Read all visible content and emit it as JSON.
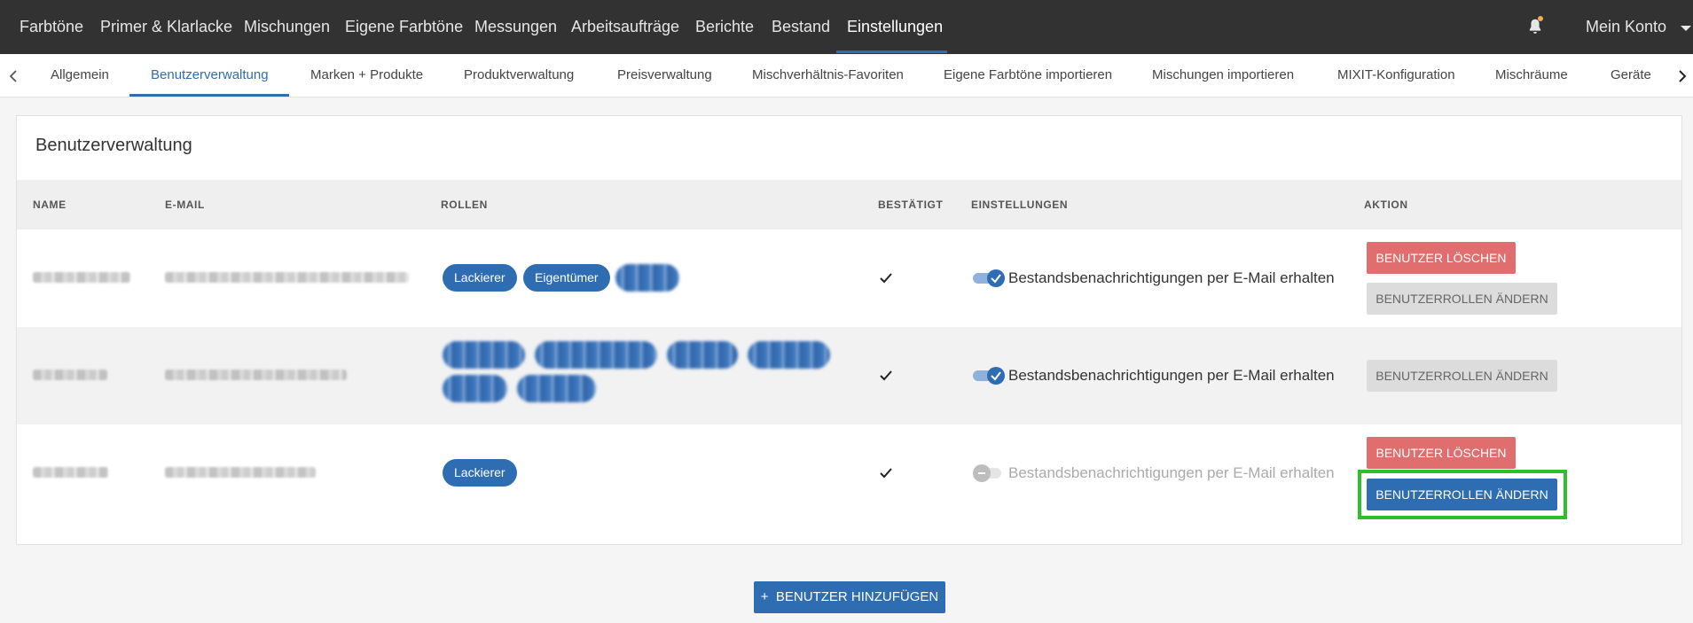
{
  "topnav": {
    "items": [
      "Farbtöne",
      "Primer & Klarlacke",
      "Mischungen",
      "Eigene Farbtöne",
      "Messungen",
      "Arbeitsaufträge",
      "Berichte",
      "Bestand",
      "Einstellungen"
    ],
    "account_label": "Mein Konto"
  },
  "subnav": {
    "tabs": [
      "Allgemein",
      "Benutzerverwaltung",
      "Marken + Produkte",
      "Produktverwaltung",
      "Preisverwaltung",
      "Mischverhältnis-Favoriten",
      "Eigene Farbtöne importieren",
      "Mischungen importieren",
      "MIXIT-Konfiguration",
      "Mischräume",
      "Geräte"
    ]
  },
  "card": {
    "title": "Benutzerverwaltung",
    "columns": [
      "NAME",
      "E-MAIL",
      "ROLLEN",
      "BESTÄTIGT",
      "EINSTELLUNGEN",
      "AKTION"
    ],
    "rows": [
      {
        "roles": [
          "Lackierer",
          "Eigentümer"
        ],
        "setting_label": "Bestandsbenachrichtigungen per E-Mail erhalten",
        "setting_enabled": true,
        "actions": [
          "BENUTZER LÖSCHEN",
          "BENUTZERROLLEN ÄNDERN"
        ]
      },
      {
        "roles": [],
        "setting_label": "Bestandsbenachrichtigungen per E-Mail erhalten",
        "setting_enabled": true,
        "actions": [
          "BENUTZERROLLEN ÄNDERN"
        ]
      },
      {
        "roles": [
          "Lackierer"
        ],
        "setting_label": "Bestandsbenachrichtigungen per E-Mail erhalten",
        "setting_enabled": false,
        "actions": [
          "BENUTZER LÖSCHEN",
          "BENUTZERROLLEN ÄNDERN"
        ]
      }
    ]
  },
  "add_user_label": "BENUTZER HINZUFÜGEN",
  "colors": {
    "primary": "#2f6db3",
    "danger": "#e06e6e",
    "nav_bg": "#323232",
    "highlight": "#2ec02b"
  }
}
